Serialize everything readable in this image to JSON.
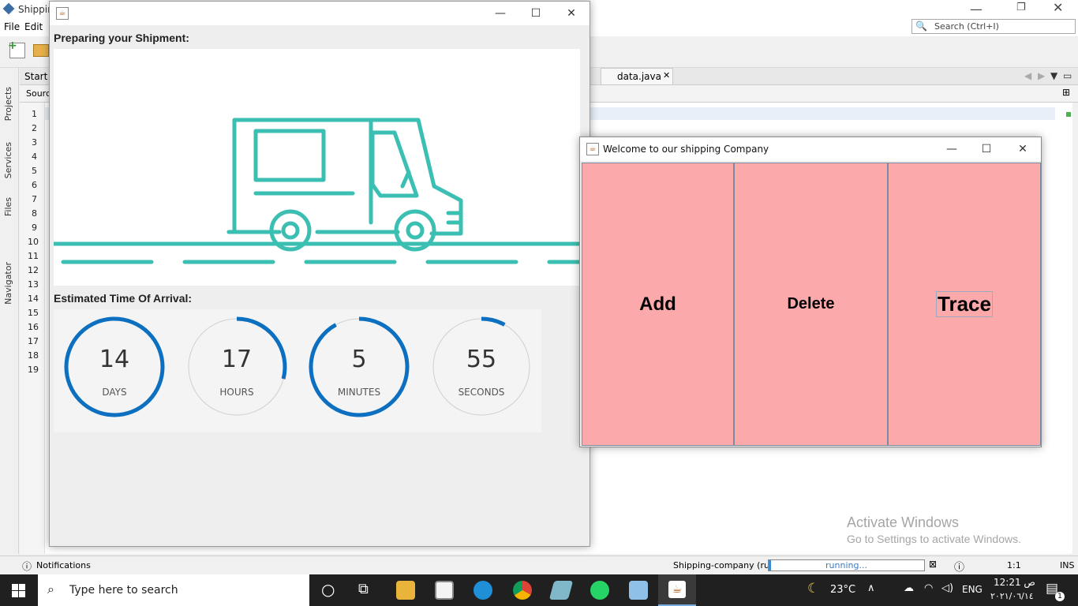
{
  "ide": {
    "title": "Shippin",
    "menu": [
      "File",
      "Edit"
    ],
    "search_placeholder": "Search (Ctrl+I)",
    "tabs": {
      "start": "Start P",
      "data_tab": "data.java"
    },
    "source_tab": "Source",
    "side_tabs": [
      "Projects",
      "Services",
      "Files",
      "Navigator"
    ],
    "line_numbers": [
      "1",
      "2",
      "3",
      "4",
      "5",
      "6",
      "7",
      "8",
      "9",
      "10",
      "11",
      "12",
      "13",
      "14",
      "15",
      "16",
      "17",
      "18",
      "19"
    ],
    "status": {
      "notifications": "Notifications",
      "project": "Shipping-company (run)",
      "progress_text": "running...",
      "position": "1:1",
      "mode": "INS"
    }
  },
  "shipment_window": {
    "section_title": "Preparing your Shipment:",
    "eta_title": "Estimated Time Of Arrival:",
    "timers": [
      {
        "value": "14",
        "label": "DAYS",
        "progress": 1.0
      },
      {
        "value": "17",
        "label": "HOURS",
        "progress": 0.29
      },
      {
        "value": "5",
        "label": "MINUTES",
        "progress": 0.92
      },
      {
        "value": "55",
        "label": "SECONDS",
        "progress": 0.08
      }
    ],
    "accent_color": "#3bbfb2",
    "ring_color": "#0d6fbf"
  },
  "welcome_window": {
    "title": "Welcome to our shipping Company",
    "buttons": {
      "add": "Add",
      "delete": "Delete",
      "trace": "Trace"
    },
    "button_color": "#fca9ab"
  },
  "watermark": {
    "line1": "Activate Windows",
    "line2": "Go to Settings to activate Windows."
  },
  "taskbar": {
    "search_placeholder": "Type here to search",
    "weather": "23°C",
    "lang": "ENG",
    "time": "12:21 ص",
    "date": "٢٠٢١/٠٦/١٤",
    "notification_count": "1"
  }
}
